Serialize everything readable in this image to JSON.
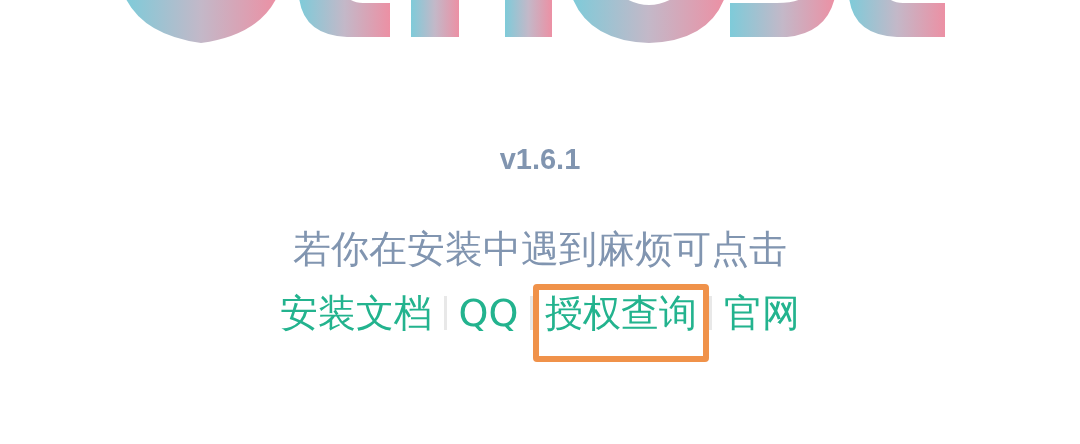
{
  "version": "v1.6.1",
  "message": "若你在安装中遇到麻烦可点击",
  "links": [
    {
      "label": "安装文档",
      "highlighted": false
    },
    {
      "label": "QQ",
      "highlighted": false
    },
    {
      "label": "授权查询",
      "highlighted": true
    },
    {
      "label": "官网",
      "highlighted": false
    }
  ]
}
